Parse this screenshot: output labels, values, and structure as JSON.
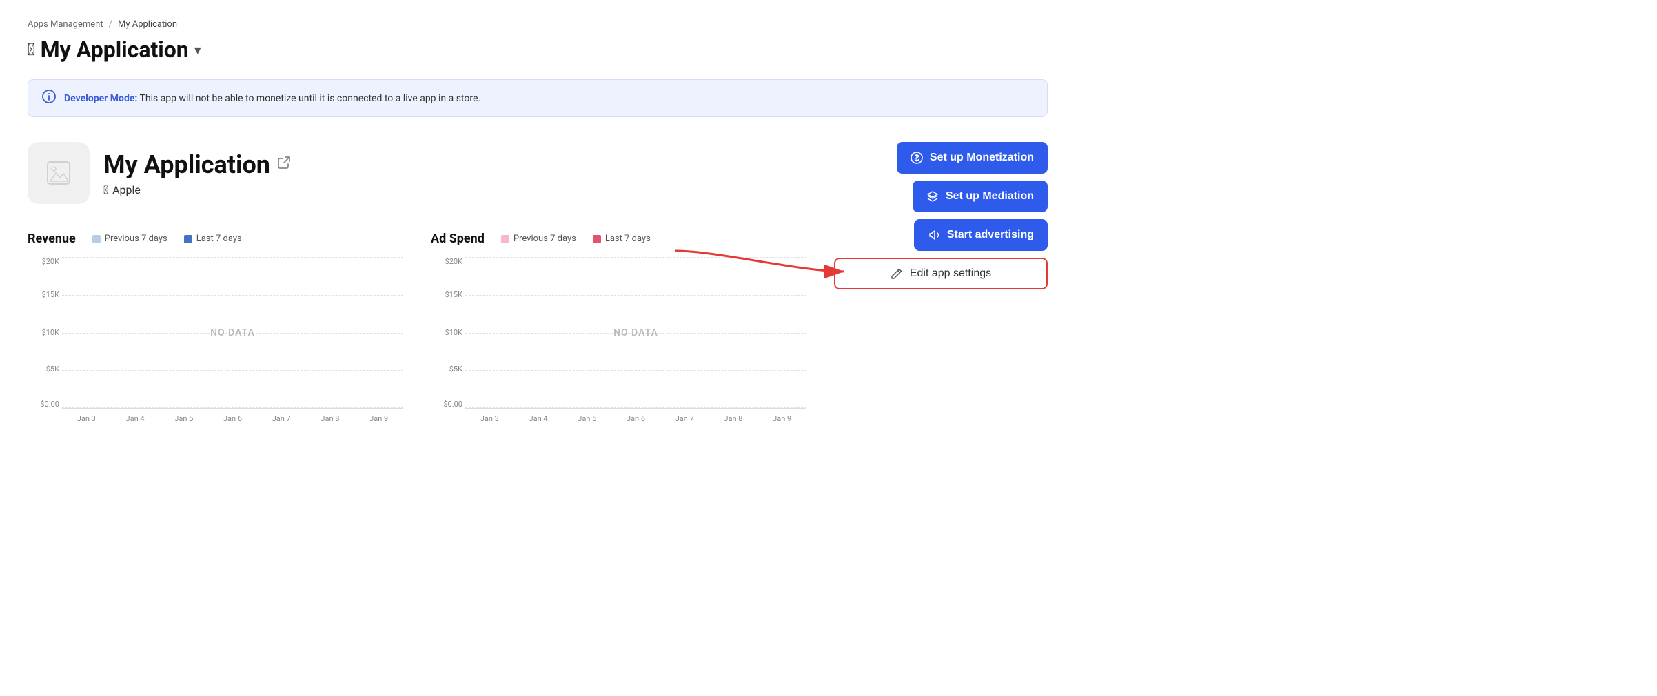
{
  "breadcrumb": {
    "parent": "Apps Management",
    "separator": "/",
    "current": "My Application"
  },
  "pageTitle": {
    "icon": "apple",
    "label": "My Application",
    "chevron": "▾"
  },
  "devBanner": {
    "icon": "ⓘ",
    "text": " This app will not be able to monetize until it is connected to a live app in a store.",
    "bold": "Developer Mode:"
  },
  "appInfo": {
    "name": "My Application",
    "platform": "Apple"
  },
  "buttons": {
    "monetization": "Set up Monetization",
    "mediation": "Set up Mediation",
    "advertising": "Start advertising",
    "editSettings": "Edit app settings"
  },
  "revenueChart": {
    "title": "Revenue",
    "legend": {
      "prev": "Previous 7 days",
      "last": "Last 7 days"
    },
    "yLabels": [
      "$20K",
      "$15K",
      "$10K",
      "$5K",
      "$0.00"
    ],
    "xLabels": [
      "Jan 3",
      "Jan 4",
      "Jan 5",
      "Jan 6",
      "Jan 7",
      "Jan 8",
      "Jan 9"
    ],
    "noData": "NO DATA"
  },
  "adSpendChart": {
    "title": "Ad Spend",
    "legend": {
      "prev": "Previous 7 days",
      "last": "Last 7 days"
    },
    "yLabels": [
      "$20K",
      "$15K",
      "$10K",
      "$5K",
      "$0.00"
    ],
    "xLabels": [
      "Jan 3",
      "Jan 4",
      "Jan 5",
      "Jan 6",
      "Jan 7",
      "Jan 8",
      "Jan 9"
    ],
    "noData": "NO DATA"
  }
}
